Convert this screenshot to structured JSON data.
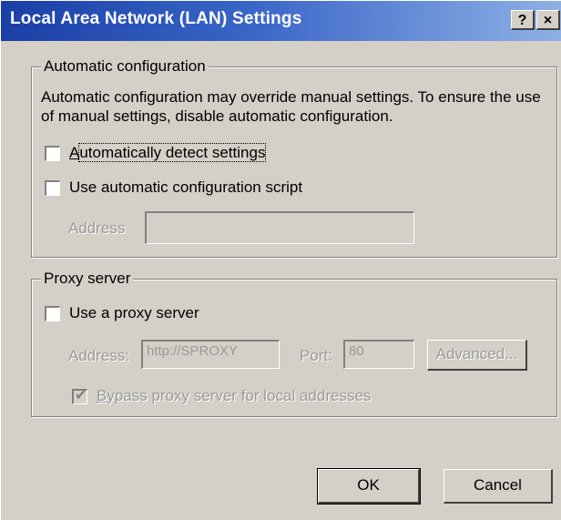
{
  "window": {
    "title": "Local Area Network (LAN) Settings",
    "help_button": "?",
    "close_button": "×"
  },
  "auto_config": {
    "legend": "Automatic configuration",
    "description": "Automatic configuration may override manual settings.  To ensure the use of manual settings, disable automatic configuration.",
    "auto_detect": {
      "label_mnemonic": "A",
      "label_rest": "utomatically detect settings",
      "checked": false
    },
    "use_script": {
      "label": "Use automatic configuration script",
      "checked": false
    },
    "address_label": "Address",
    "address_value": ""
  },
  "proxy": {
    "legend": "Proxy server",
    "use_proxy": {
      "label": "Use a proxy server",
      "checked": false
    },
    "address_label": "Address:",
    "address_value": "http://SPROXY",
    "port_label": "Port:",
    "port_value": "80",
    "advanced_label": "Advanced...",
    "bypass": {
      "label_mnemonic": "B",
      "label_rest": "ypass proxy server for local addresses",
      "checked": true
    }
  },
  "buttons": {
    "ok": "OK",
    "cancel": "Cancel"
  },
  "colors": {
    "title_start": "#1a3fa6",
    "title_end": "#8fb0e6",
    "face": "#d4d0c8"
  }
}
